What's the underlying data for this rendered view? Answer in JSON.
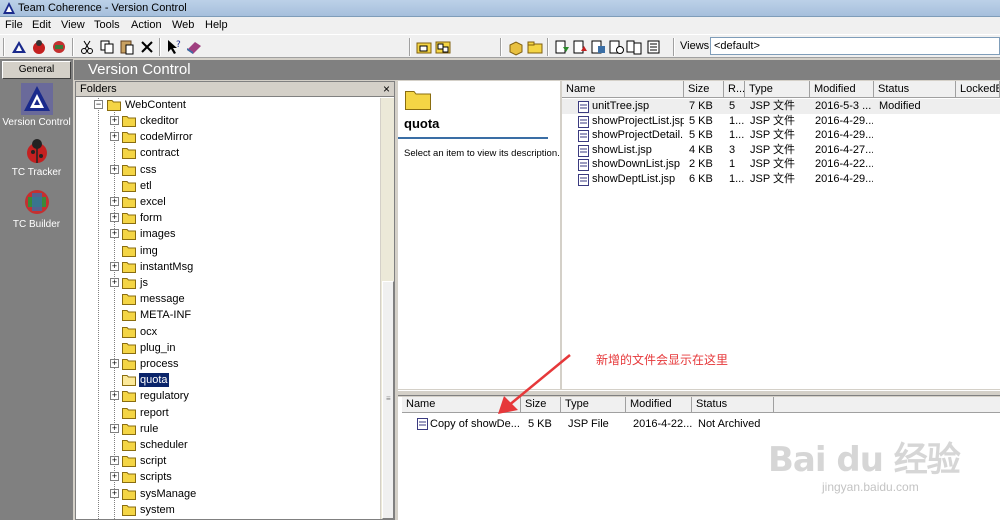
{
  "window": {
    "title": "Team Coherence - Version Control"
  },
  "menu": [
    "File",
    "Edit",
    "View",
    "Tools",
    "Action",
    "Web",
    "Help"
  ],
  "toolbar": {
    "views_label": "Views",
    "views_value": "<default>"
  },
  "left_bar": {
    "general_tab": "General",
    "items": [
      {
        "label": "Version Control",
        "icon": "version-control-icon"
      },
      {
        "label": "TC Tracker",
        "icon": "bug-tracker-icon"
      },
      {
        "label": "TC Builder",
        "icon": "builder-icon"
      }
    ]
  },
  "header": {
    "title": "Version Control"
  },
  "folders": {
    "title": "Folders",
    "close": "×",
    "root": "WebContent",
    "items": [
      {
        "label": "ckeditor",
        "expandable": true
      },
      {
        "label": "codeMirror",
        "expandable": true
      },
      {
        "label": "contract",
        "expandable": false
      },
      {
        "label": "css",
        "expandable": true
      },
      {
        "label": "etl",
        "expandable": false
      },
      {
        "label": "excel",
        "expandable": true
      },
      {
        "label": "form",
        "expandable": true
      },
      {
        "label": "images",
        "expandable": true
      },
      {
        "label": "img",
        "expandable": false
      },
      {
        "label": "instantMsg",
        "expandable": true
      },
      {
        "label": "js",
        "expandable": true
      },
      {
        "label": "message",
        "expandable": false
      },
      {
        "label": "META-INF",
        "expandable": false
      },
      {
        "label": "ocx",
        "expandable": false
      },
      {
        "label": "plug_in",
        "expandable": false
      },
      {
        "label": "process",
        "expandable": true
      },
      {
        "label": "quota",
        "expandable": false,
        "selected": true
      },
      {
        "label": "regulatory",
        "expandable": true
      },
      {
        "label": "report",
        "expandable": false
      },
      {
        "label": "rule",
        "expandable": true
      },
      {
        "label": "scheduler",
        "expandable": false
      },
      {
        "label": "script",
        "expandable": true
      },
      {
        "label": "scripts",
        "expandable": true
      },
      {
        "label": "sysManage",
        "expandable": true
      },
      {
        "label": "system",
        "expandable": false
      }
    ]
  },
  "description": {
    "title": "quota",
    "text": "Select an item to view its description."
  },
  "file_list": {
    "columns": [
      "Name",
      "Size",
      "R...",
      "Type",
      "Modified",
      "Status",
      "LockedBy"
    ],
    "rows": [
      {
        "name": "unitTree.jsp",
        "size": "7 KB",
        "rev": "5",
        "type": "JSP 文件",
        "modified": "2016-5-3 ...",
        "status": "Modified"
      },
      {
        "name": "showProjectList.jsp",
        "size": "5 KB",
        "rev": "1...",
        "type": "JSP 文件",
        "modified": "2016-4-29...",
        "status": ""
      },
      {
        "name": "showProjectDetail...",
        "size": "5 KB",
        "rev": "1...",
        "type": "JSP 文件",
        "modified": "2016-4-29...",
        "status": ""
      },
      {
        "name": "showList.jsp",
        "size": "4 KB",
        "rev": "3",
        "type": "JSP 文件",
        "modified": "2016-4-27...",
        "status": ""
      },
      {
        "name": "showDownList.jsp",
        "size": "2 KB",
        "rev": "1",
        "type": "JSP 文件",
        "modified": "2016-4-22...",
        "status": ""
      },
      {
        "name": "showDeptList.jsp",
        "size": "6 KB",
        "rev": "1...",
        "type": "JSP 文件",
        "modified": "2016-4-29...",
        "status": ""
      }
    ]
  },
  "new_files": {
    "columns": [
      "Name",
      "Size",
      "Type",
      "Modified",
      "Status"
    ],
    "rows": [
      {
        "name": "Copy of showDe...",
        "size": "5 KB",
        "type": "JSP File",
        "modified": "2016-4-22...",
        "status": "Not Archived"
      }
    ]
  },
  "annotation": {
    "text": "新增的文件会显示在这里",
    "color": "#e6383a"
  },
  "watermark": {
    "brand": "Bai du 经验",
    "url": "jingyan.baidu.com"
  },
  "colors": {
    "selection": "#0a246a",
    "panel_header": "#808080",
    "folder_yellow": "#f4d545"
  }
}
